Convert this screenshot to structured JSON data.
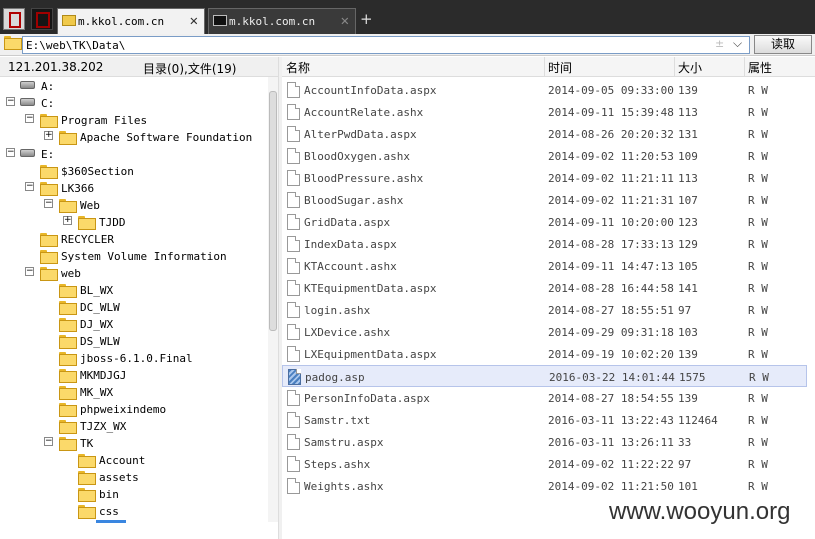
{
  "tabs": [
    {
      "label": "m.kkol.com.cn",
      "active": true
    },
    {
      "label": "m.kkol.com.cn",
      "active": false
    }
  ],
  "new_tab_label": "+",
  "tab_close_glyph": "✕",
  "address": {
    "path": "E:\\web\\TK\\Data\\",
    "separator_glyph": "±",
    "dropdown_glyph": "⌵",
    "read_button": "读取"
  },
  "server_ip": "121.201.38.202",
  "summary": "目录(0),文件(19)",
  "tree": [
    {
      "label": "A:",
      "icon": "drive-icon",
      "toggle": ""
    },
    {
      "label": "C:",
      "icon": "drive-icon",
      "toggle": "−"
    },
    {
      "label": "Program Files",
      "icon": "folder-icon",
      "toggle": "−"
    },
    {
      "label": "Apache Software Foundation",
      "icon": "folder-icon",
      "toggle": "+"
    },
    {
      "label": "E:",
      "icon": "drive-icon",
      "toggle": "−"
    },
    {
      "label": "$360Section",
      "icon": "folder-icon",
      "toggle": ""
    },
    {
      "label": "LK366",
      "icon": "folder-icon",
      "toggle": "−"
    },
    {
      "label": "Web",
      "icon": "folder-icon",
      "toggle": "−"
    },
    {
      "label": "TJDD",
      "icon": "folder-icon",
      "toggle": "+"
    },
    {
      "label": "RECYCLER",
      "icon": "folder-icon",
      "toggle": ""
    },
    {
      "label": "System Volume Information",
      "icon": "folder-icon",
      "toggle": ""
    },
    {
      "label": "web",
      "icon": "folder-icon",
      "toggle": "−"
    },
    {
      "label": "BL_WX",
      "icon": "folder-icon",
      "toggle": ""
    },
    {
      "label": "DC_WLW",
      "icon": "folder-icon",
      "toggle": ""
    },
    {
      "label": "DJ_WX",
      "icon": "folder-icon",
      "toggle": ""
    },
    {
      "label": "DS_WLW",
      "icon": "folder-icon",
      "toggle": ""
    },
    {
      "label": "jboss-6.1.0.Final",
      "icon": "folder-icon",
      "toggle": ""
    },
    {
      "label": "MKMDJGJ",
      "icon": "folder-icon",
      "toggle": ""
    },
    {
      "label": "MK_WX",
      "icon": "folder-icon",
      "toggle": ""
    },
    {
      "label": "phpweixindemo",
      "icon": "folder-icon",
      "toggle": ""
    },
    {
      "label": "TJZX_WX",
      "icon": "folder-icon",
      "toggle": ""
    },
    {
      "label": "TK",
      "icon": "folder-icon",
      "toggle": "−"
    },
    {
      "label": "Account",
      "icon": "folder-icon",
      "toggle": ""
    },
    {
      "label": "assets",
      "icon": "folder-icon",
      "toggle": ""
    },
    {
      "label": "bin",
      "icon": "folder-icon",
      "toggle": ""
    },
    {
      "label": "css",
      "icon": "folder-icon",
      "toggle": ""
    }
  ],
  "columns": {
    "name": "名称",
    "time": "时间",
    "size": "大小",
    "attr": "属性"
  },
  "files": [
    {
      "name": "AccountInfoData.aspx",
      "time": "2014-09-05 09:33:00",
      "size": "139",
      "attr": "R W"
    },
    {
      "name": "AccountRelate.ashx",
      "time": "2014-09-11 15:39:48",
      "size": "113",
      "attr": "R W"
    },
    {
      "name": "AlterPwdData.aspx",
      "time": "2014-08-26 20:20:32",
      "size": "131",
      "attr": "R W"
    },
    {
      "name": "BloodOxygen.ashx",
      "time": "2014-09-02 11:20:53",
      "size": "109",
      "attr": "R W"
    },
    {
      "name": "BloodPressure.ashx",
      "time": "2014-09-02 11:21:11",
      "size": "113",
      "attr": "R W"
    },
    {
      "name": "BloodSugar.ashx",
      "time": "2014-09-02 11:21:31",
      "size": "107",
      "attr": "R W"
    },
    {
      "name": "GridData.aspx",
      "time": "2014-09-11 10:20:00",
      "size": "123",
      "attr": "R W"
    },
    {
      "name": "IndexData.aspx",
      "time": "2014-08-28 17:33:13",
      "size": "129",
      "attr": "R W"
    },
    {
      "name": "KTAccount.ashx",
      "time": "2014-09-11 14:47:13",
      "size": "105",
      "attr": "R W"
    },
    {
      "name": "KTEquipmentData.aspx",
      "time": "2014-08-28 16:44:58",
      "size": "141",
      "attr": "R W"
    },
    {
      "name": "login.ashx",
      "time": "2014-08-27 18:55:51",
      "size": "97",
      "attr": "R W"
    },
    {
      "name": "LXDevice.ashx",
      "time": "2014-09-29 09:31:18",
      "size": "103",
      "attr": "R W"
    },
    {
      "name": "LXEquipmentData.aspx",
      "time": "2014-09-19 10:02:20",
      "size": "139",
      "attr": "R W"
    },
    {
      "name": "padog.asp",
      "time": "2016-03-22 14:01:44",
      "size": "1575",
      "attr": "R W",
      "selected": true
    },
    {
      "name": "PersonInfoData.aspx",
      "time": "2014-08-27 18:54:55",
      "size": "139",
      "attr": "R W"
    },
    {
      "name": "Samstr.txt",
      "time": "2016-03-11 13:22:43",
      "size": "112464",
      "attr": "R W"
    },
    {
      "name": "Samstru.aspx",
      "time": "2016-03-11 13:26:11",
      "size": "33",
      "attr": "R W"
    },
    {
      "name": "Steps.ashx",
      "time": "2014-09-02 11:22:22",
      "size": "97",
      "attr": "R W"
    },
    {
      "name": "Weights.ashx",
      "time": "2014-09-02 11:21:50",
      "size": "101",
      "attr": "R W"
    }
  ],
  "watermark": "www.wooyun.org",
  "colors": {
    "tabbar": "#2b2b2b",
    "selection": "#e6ebfa",
    "folder": "#fbd96a",
    "accent": "#3a86e0"
  }
}
